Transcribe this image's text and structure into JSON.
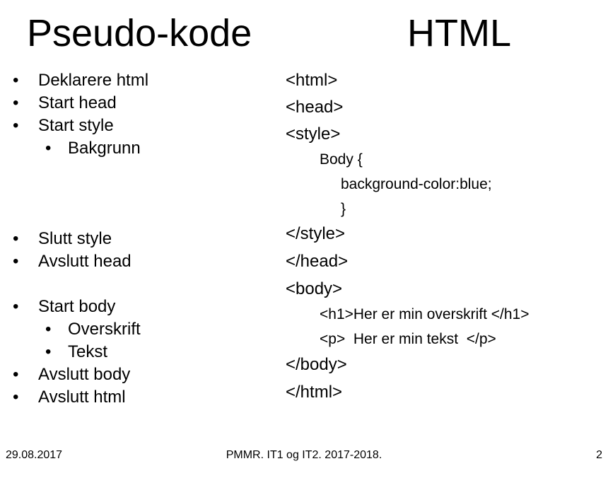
{
  "titles": {
    "left": "Pseudo-kode",
    "right": "HTML"
  },
  "bullet_symbol": "•",
  "pseudo": {
    "items": [
      "Deklarere html",
      "Start head",
      "Start style",
      "Bakgrunn",
      "Slutt style",
      "Avslutt head",
      "Start body",
      "Overskrift",
      "Tekst",
      "Avslutt body",
      "Avslutt html"
    ]
  },
  "code": {
    "lines": [
      "<html>",
      "<head>",
      "<style>",
      "Body {",
      "background-color:blue;",
      "}",
      "</style>",
      "</head>",
      "<body>",
      "<h1>Her er min overskrift </h1>",
      "<p>  Her er min tekst  </p>",
      "</body>",
      "</html>"
    ]
  },
  "footer": {
    "date": "29.08.2017",
    "center": "PMMR. IT1 og IT2. 2017-2018.",
    "page": "2"
  }
}
